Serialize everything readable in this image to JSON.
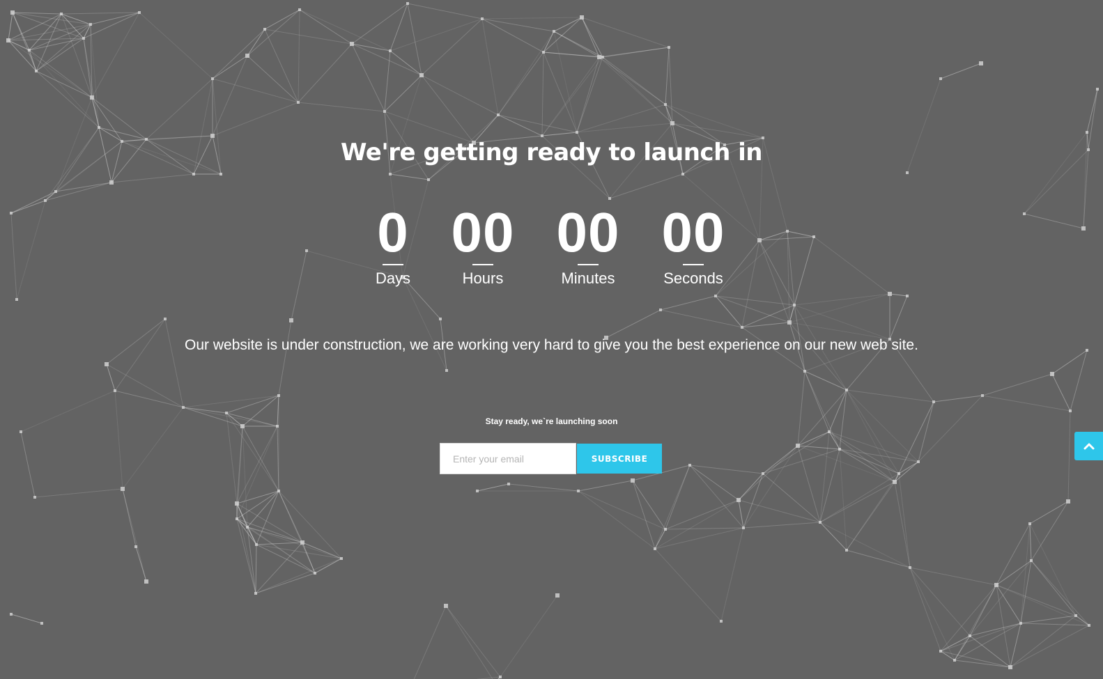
{
  "headline": "We're getting ready to launch in",
  "countdown": [
    {
      "value": "0",
      "label": "Days"
    },
    {
      "value": "00",
      "label": "Hours"
    },
    {
      "value": "00",
      "label": "Minutes"
    },
    {
      "value": "00",
      "label": "Seconds"
    }
  ],
  "message": "Our website is under construction, we are working very hard to give you the best experience on our new web site.",
  "subscribe": {
    "tagline": "Stay ready, we`re launching soon",
    "email_placeholder": "Enter your email",
    "button_label": "SUBSCRIBE"
  },
  "scroll_top_icon": "chevron-up-icon",
  "colors": {
    "background": "#636363",
    "accent": "#2ec6ea",
    "text": "#ffffff"
  }
}
